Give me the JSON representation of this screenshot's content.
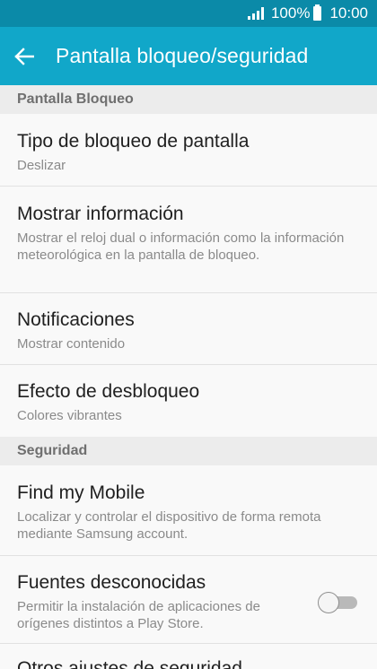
{
  "status_bar": {
    "battery": "100%",
    "time": "10:00",
    "icons": [
      "signal-icon",
      "battery-icon"
    ]
  },
  "app_bar": {
    "title": "Pantalla bloqueo/seguridad",
    "back_icon": "arrow-left-icon"
  },
  "sections": {
    "lock_screen": {
      "header": "Pantalla Bloqueo",
      "items": [
        {
          "title": "Tipo de bloqueo de pantalla",
          "subtitle": "Deslizar"
        },
        {
          "title": "Mostrar información",
          "subtitle": "Mostrar el reloj dual o información como la información meteorológica en la pantalla de bloqueo."
        },
        {
          "title": "Notificaciones",
          "subtitle": "Mostrar contenido"
        },
        {
          "title": "Efecto de desbloqueo",
          "subtitle": "Colores vibrantes"
        }
      ]
    },
    "security": {
      "header": "Seguridad",
      "items": [
        {
          "title": "Find my Mobile",
          "subtitle": "Localizar y controlar el dispositivo de forma remota mediante Samsung account."
        },
        {
          "title": "Fuentes desconocidas",
          "subtitle": "Permitir la instalación de aplicaciones de orígenes distintos a Play Store.",
          "toggle": "off"
        },
        {
          "title": "Otros ajustes de seguridad"
        }
      ]
    }
  },
  "colors": {
    "status_bar": "#0b8aa8",
    "app_bar": "#11a7c9",
    "background": "#f9f9f9",
    "section_header": "#ececec"
  }
}
